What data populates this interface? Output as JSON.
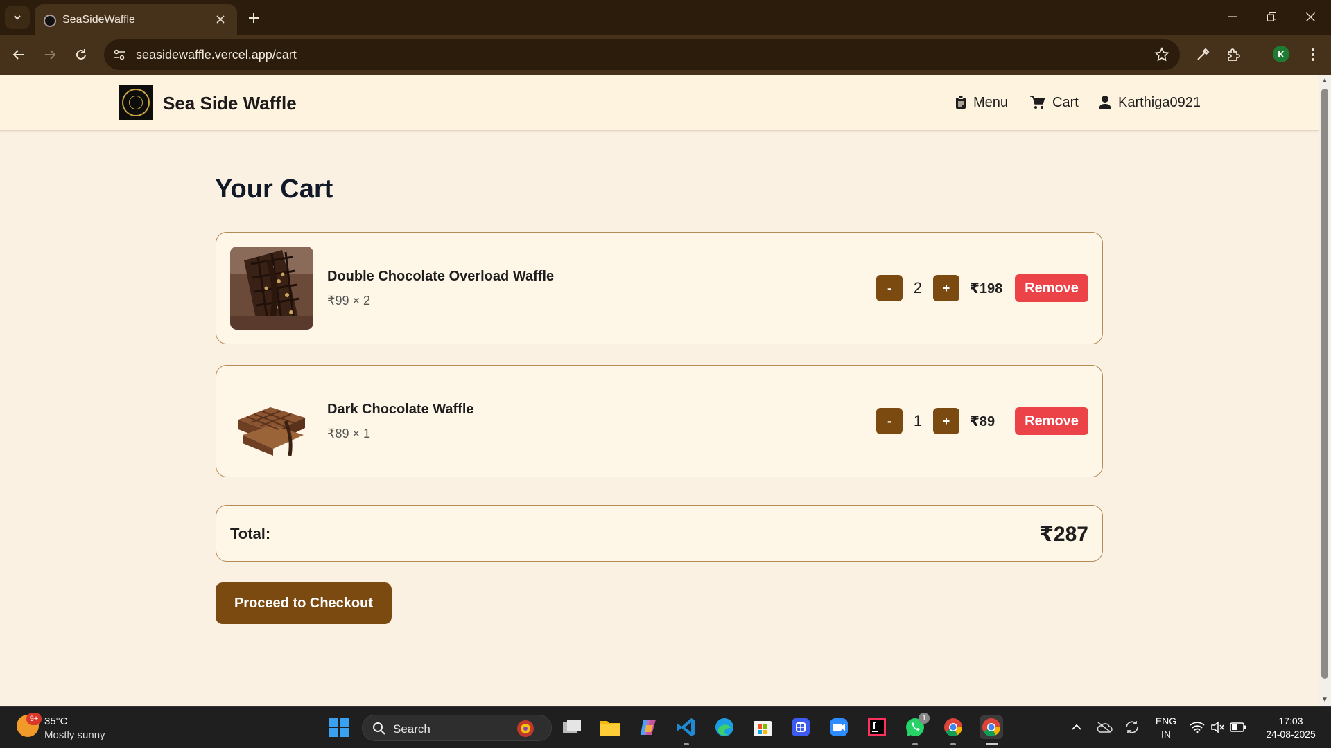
{
  "browser": {
    "tab_title": "SeaSideWaffle",
    "url": "seasidewaffle.vercel.app/cart",
    "profile_initial": "K"
  },
  "header": {
    "brand": "Sea Side Waffle",
    "nav": {
      "menu": "Menu",
      "cart": "Cart",
      "user": "Karthiga0921"
    }
  },
  "page": {
    "title": "Your Cart"
  },
  "cart": {
    "items": [
      {
        "name": "Double Chocolate Overload Waffle",
        "unit_line": "₹99 × 2",
        "qty": "2",
        "line_total": "₹198",
        "remove_label": "Remove",
        "minus": "-",
        "plus": "+"
      },
      {
        "name": "Dark Chocolate Waffle",
        "unit_line": "₹89 × 1",
        "qty": "1",
        "line_total": "₹89",
        "remove_label": "Remove",
        "minus": "-",
        "plus": "+"
      }
    ],
    "total_label": "Total:",
    "total_value": "₹287",
    "checkout_label": "Proceed to Checkout"
  },
  "taskbar": {
    "weather_temp": "35°C",
    "weather_cond": "Mostly sunny",
    "weather_badge": "9+",
    "search_label": "Search",
    "lang_line1": "ENG",
    "lang_line2": "IN",
    "time": "17:03",
    "date": "24-08-2025",
    "whatsapp_badge": "1"
  },
  "colors": {
    "brand_brown": "#7b4a10",
    "remove_red": "#ec4349",
    "page_bg": "#fbf1e3",
    "chrome_dark": "#2b1c0b"
  }
}
